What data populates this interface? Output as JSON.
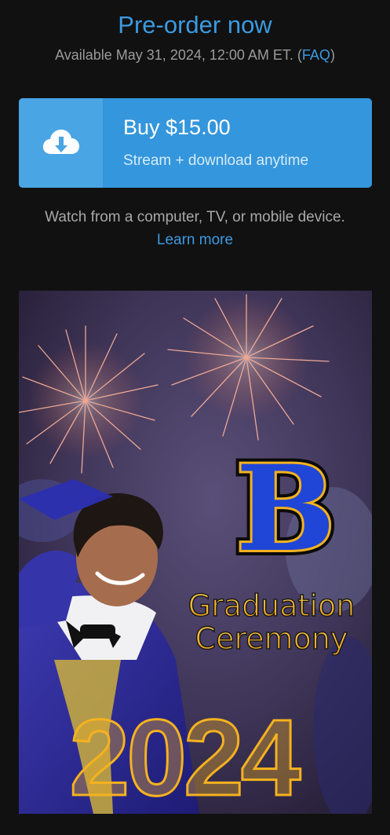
{
  "header": {
    "title": "Pre-order now",
    "availability_prefix": "Available May 31, 2024, 12:00 AM ET. (",
    "faq_label": "FAQ",
    "availability_suffix": ")"
  },
  "buy_button": {
    "icon": "cloud-download-icon",
    "price_label": "Buy $15.00",
    "sub_label": "Stream + download anytime"
  },
  "info": {
    "watch_text": "Watch from a computer, TV, or mobile device.",
    "learn_more_label": "Learn more"
  },
  "poster": {
    "logo_letter": "B",
    "line1": "Graduation",
    "line2": "Ceremony",
    "year": "2024"
  },
  "colors": {
    "accent": "#3b9ae1",
    "button": "#3496dc",
    "background": "#111111",
    "poster_gold": "#f5b21f",
    "poster_blue": "#1f46d6"
  }
}
